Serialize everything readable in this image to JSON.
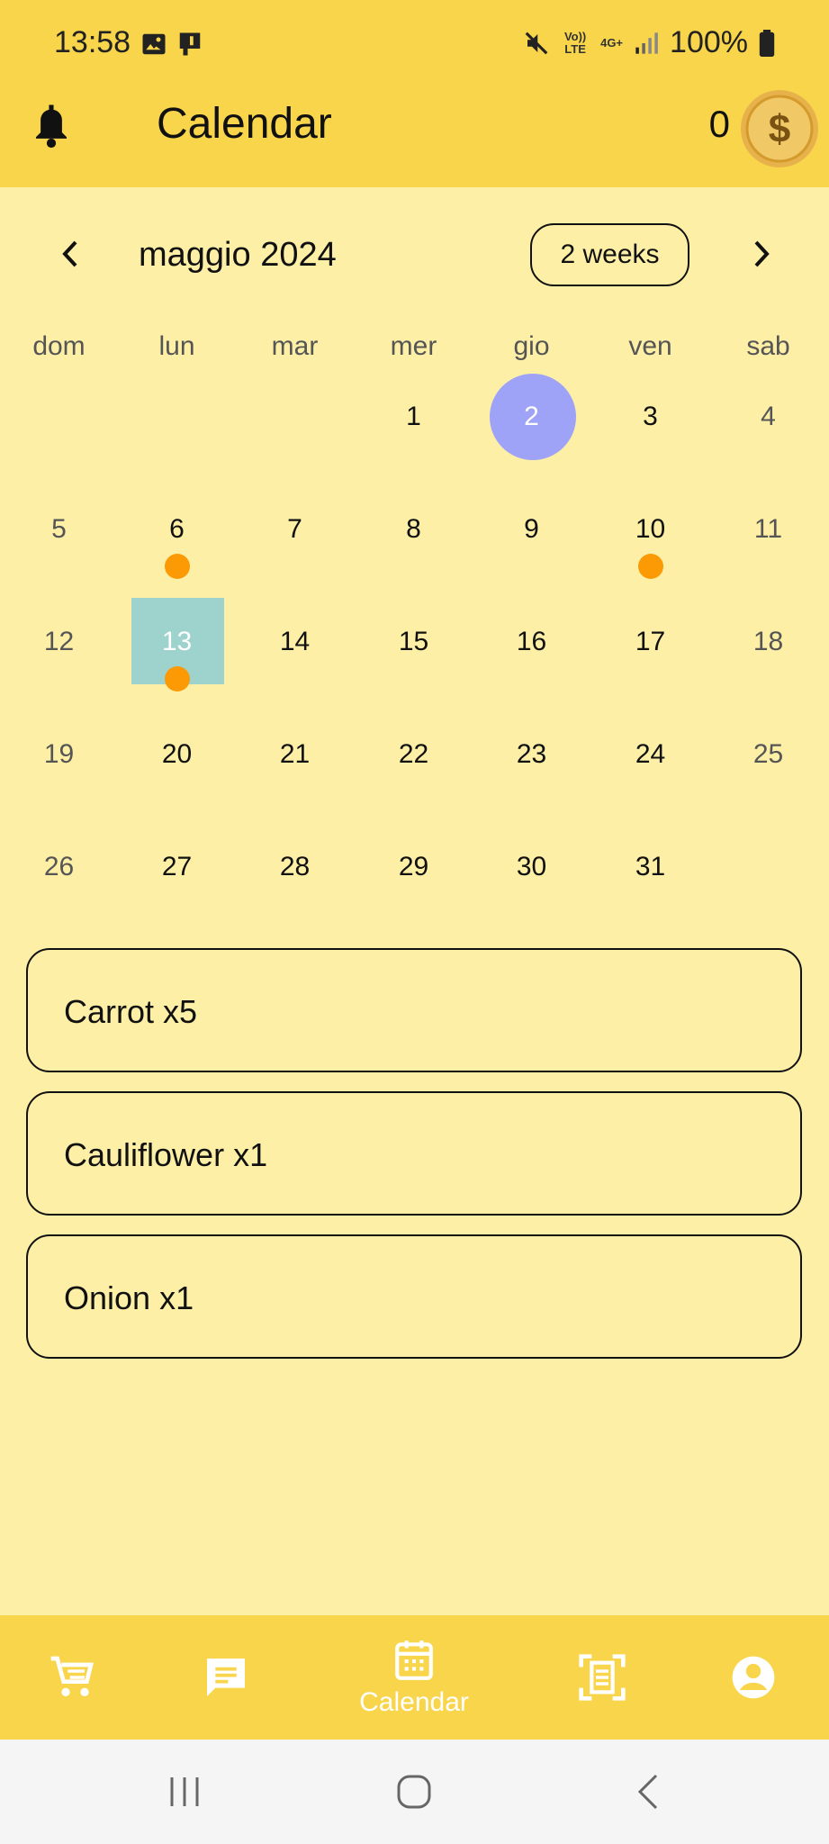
{
  "status_bar": {
    "time": "13:58",
    "battery": "100%",
    "network_top": "Vo)) LTE",
    "network_4g": "4G+"
  },
  "app_bar": {
    "title": "Calendar",
    "coin_count": "0",
    "coin_symbol": "$"
  },
  "calendar": {
    "month_title": "maggio 2024",
    "format_button": "2 weeks",
    "weekdays": [
      "dom",
      "lun",
      "mar",
      "mer",
      "gio",
      "ven",
      "sab"
    ],
    "weeks": [
      [
        "",
        "",
        "",
        "1",
        "2",
        "3",
        "4"
      ],
      [
        "5",
        "6",
        "7",
        "8",
        "9",
        "10",
        "11"
      ],
      [
        "12",
        "13",
        "14",
        "15",
        "16",
        "17",
        "18"
      ],
      [
        "19",
        "20",
        "21",
        "22",
        "23",
        "24",
        "25"
      ],
      [
        "26",
        "27",
        "28",
        "29",
        "30",
        "31",
        ""
      ]
    ],
    "today": "2",
    "selected": "13",
    "event_days": [
      "6",
      "10",
      "13"
    ],
    "colors": {
      "today": "#9ea3f7",
      "selected": "#9ed2cc",
      "marker": "#fb9a05",
      "background": "#fdefa6",
      "bar": "#f8d54a"
    }
  },
  "events": [
    "Carrot x5",
    "Cauliflower x1",
    "Onion x1"
  ],
  "bottom_nav": {
    "items": [
      {
        "icon": "cart-icon"
      },
      {
        "icon": "chat-icon"
      },
      {
        "icon": "calendar-icon",
        "label": "Calendar",
        "active": true
      },
      {
        "icon": "scan-icon"
      },
      {
        "icon": "account-icon"
      }
    ]
  }
}
